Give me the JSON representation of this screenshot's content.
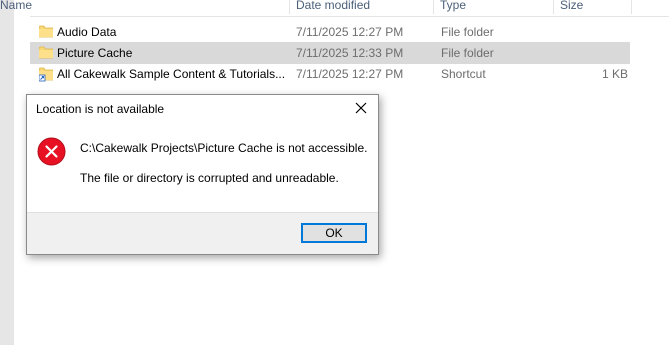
{
  "columns": {
    "name": "Name",
    "date": "Date modified",
    "type": "Type",
    "size": "Size"
  },
  "files": [
    {
      "name": "Audio Data",
      "date": "7/11/2025 12:27 PM",
      "type": "File folder",
      "size": "",
      "icon": "folder-icon",
      "selected": false
    },
    {
      "name": "Picture Cache",
      "date": "7/11/2025 12:33 PM",
      "type": "File folder",
      "size": "",
      "icon": "folder-icon",
      "selected": true
    },
    {
      "name": "All Cakewalk Sample Content & Tutorials...",
      "date": "7/11/2025 12:27 PM",
      "type": "Shortcut",
      "size": "1 KB",
      "icon": "shortcut-icon",
      "selected": false
    }
  ],
  "dialog": {
    "title": "Location is not available",
    "message_line1": "C:\\Cakewalk Projects\\Picture Cache is not accessible.",
    "message_line2": "The file or directory is corrupted and unreadable.",
    "ok_label": "OK",
    "icon": "error-icon"
  },
  "colors": {
    "selection": "#d9d9d9",
    "error_red": "#e81123",
    "accent": "#0078d7"
  }
}
